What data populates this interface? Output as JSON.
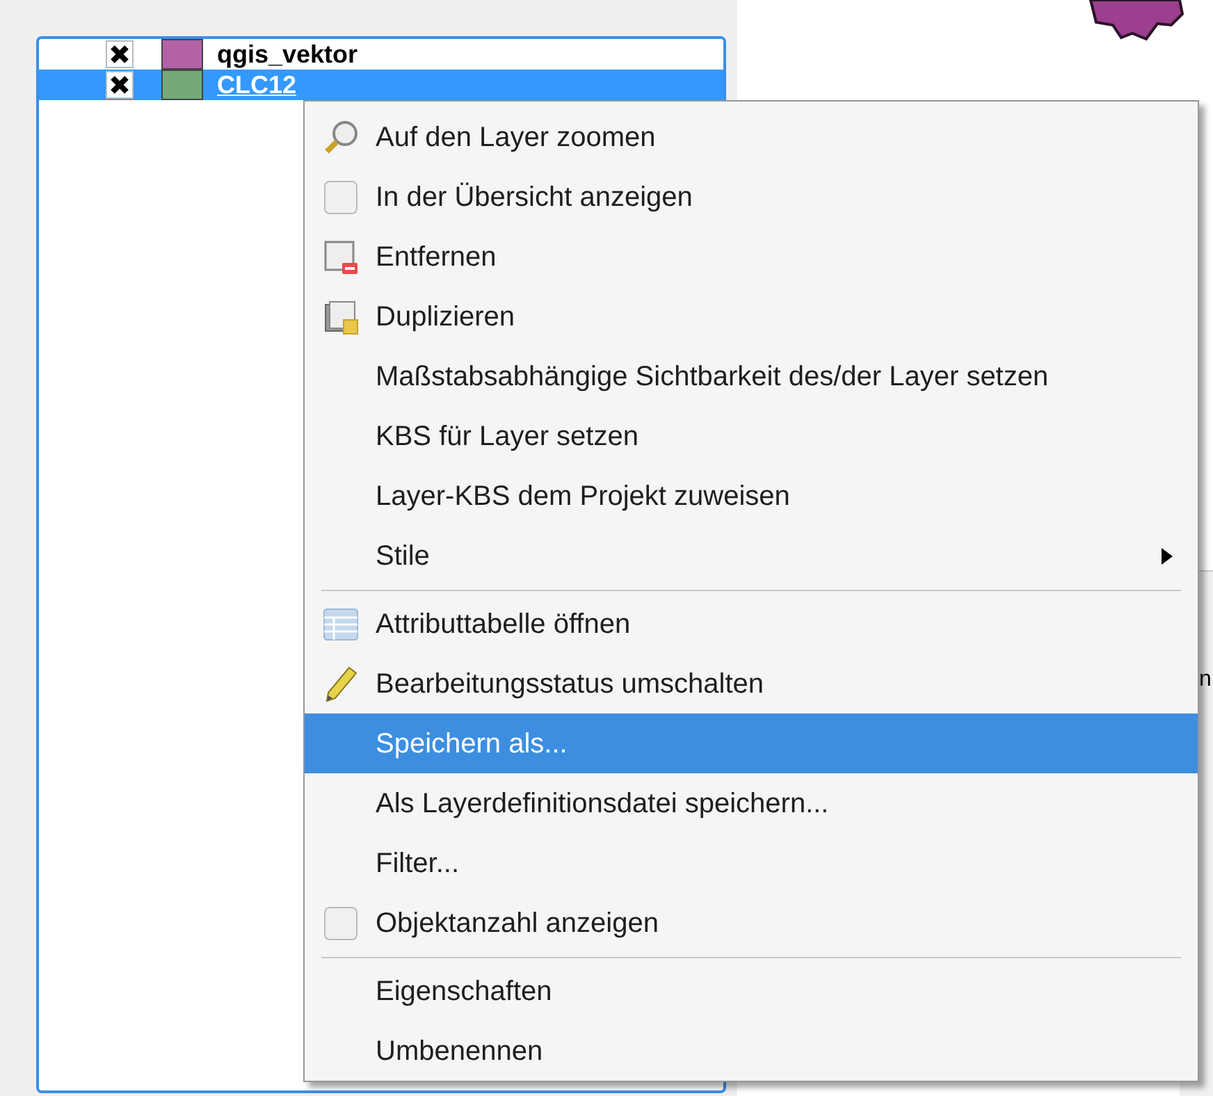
{
  "layers": [
    {
      "name": "qgis_vektor",
      "checked": true,
      "color": "#b462a8",
      "selected": false
    },
    {
      "name": "CLC12",
      "checked": true,
      "color": "#74aa78",
      "selected": true
    }
  ],
  "context_menu": [
    {
      "kind": "zoom",
      "label": "Auf den Layer zoomen",
      "selected": false
    },
    {
      "kind": "checkbox",
      "label": "In der Übersicht anzeigen",
      "checked": false,
      "selected": false
    },
    {
      "kind": "remove",
      "label": "Entfernen",
      "selected": false
    },
    {
      "kind": "duplicate",
      "label": "Duplizieren",
      "selected": false
    },
    {
      "kind": "plain",
      "label": "Maßstabsabhängige Sichtbarkeit des/der Layer setzen",
      "selected": false
    },
    {
      "kind": "plain",
      "label": "KBS für Layer setzen",
      "selected": false
    },
    {
      "kind": "plain",
      "label": "Layer-KBS dem Projekt zuweisen",
      "selected": false
    },
    {
      "kind": "submenu",
      "label": "Stile",
      "selected": false
    },
    {
      "kind": "separator"
    },
    {
      "kind": "table",
      "label": "Attributtabelle öffnen",
      "selected": false
    },
    {
      "kind": "pencil",
      "label": "Bearbeitungsstatus umschalten",
      "selected": false
    },
    {
      "kind": "plain",
      "label": "Speichern als...",
      "selected": true
    },
    {
      "kind": "plain",
      "label": "Als Layerdefinitionsdatei speichern...",
      "selected": false
    },
    {
      "kind": "plain",
      "label": "Filter...",
      "selected": false
    },
    {
      "kind": "checkbox",
      "label": "Objektanzahl anzeigen",
      "checked": false,
      "selected": false
    },
    {
      "kind": "separator"
    },
    {
      "kind": "plain",
      "label": "Eigenschaften",
      "selected": false
    },
    {
      "kind": "plain",
      "label": "Umbenennen",
      "selected": false
    }
  ],
  "side_panel": {
    "text": "n"
  }
}
